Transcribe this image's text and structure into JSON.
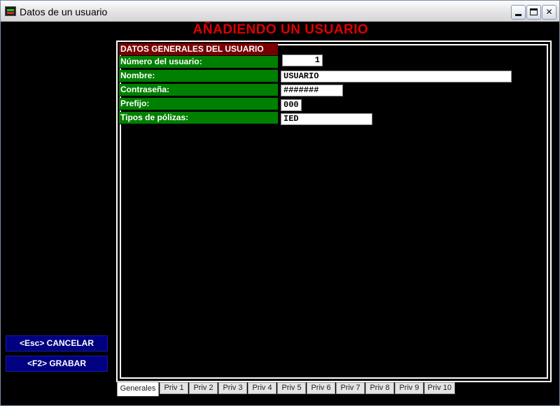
{
  "window": {
    "title": "Datos de un usuario"
  },
  "heading": "AÑADIENDO UN USUARIO",
  "section": {
    "title": "DATOS GENERALES DEL USUARIO"
  },
  "fields": {
    "numero": {
      "label": "Número del usuario:",
      "value": "1"
    },
    "nombre": {
      "label": "Nombre:",
      "value": "USUARIO"
    },
    "contrasena": {
      "label": "Contraseña:",
      "value": "#######"
    },
    "prefijo": {
      "label": "Prefijo:",
      "value": "000"
    },
    "tipos": {
      "label": "Tipos de pólizas:",
      "value": "IED"
    }
  },
  "buttons": {
    "cancelar": "<Esc>  CANCELAR",
    "grabar": "<F2>  GRABAR"
  },
  "tabs": [
    "Generales",
    "Priv 1",
    "Priv 2",
    "Priv 3",
    "Priv 4",
    "Priv 5",
    "Priv 6",
    "Priv 7",
    "Priv 8",
    "Priv 9",
    "Priv 10"
  ],
  "active_tab": "Generales",
  "colors": {
    "heading": "#e00000",
    "section_header": "#7a0000",
    "label_bg": "#008000",
    "button_bg": "#000080"
  }
}
